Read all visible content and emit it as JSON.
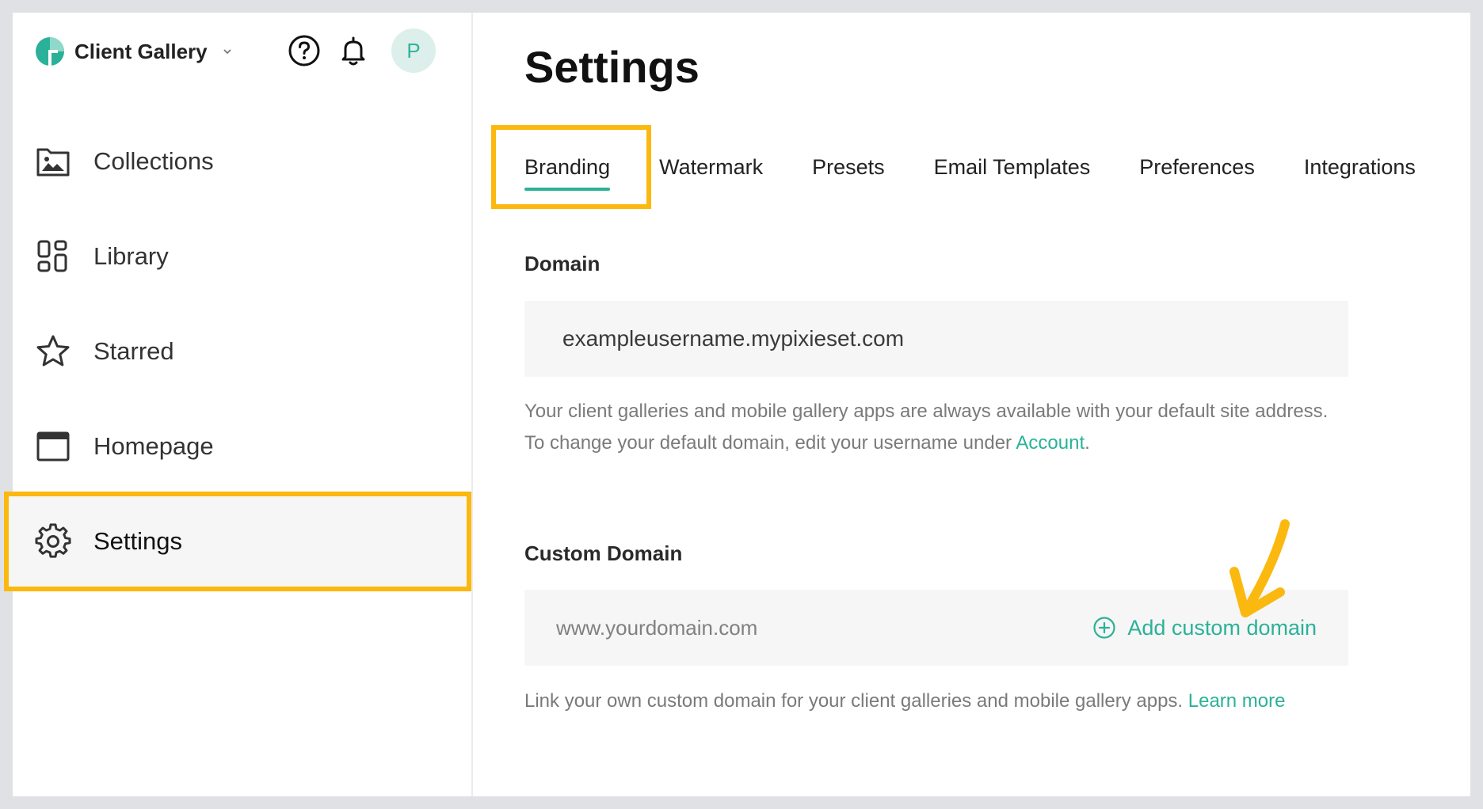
{
  "sidebar": {
    "brand_name": "Client Gallery",
    "avatar_initial": "P",
    "items": [
      {
        "label": "Collections",
        "icon": "image-folder-icon"
      },
      {
        "label": "Library",
        "icon": "grid-icon"
      },
      {
        "label": "Starred",
        "icon": "star-icon"
      },
      {
        "label": "Homepage",
        "icon": "browser-window-icon"
      },
      {
        "label": "Settings",
        "icon": "gear-icon",
        "active": true
      }
    ]
  },
  "main": {
    "title": "Settings",
    "tabs": [
      {
        "label": "Branding",
        "active": true
      },
      {
        "label": "Watermark"
      },
      {
        "label": "Presets"
      },
      {
        "label": "Email Templates"
      },
      {
        "label": "Preferences"
      },
      {
        "label": "Integrations"
      }
    ],
    "domain": {
      "label": "Domain",
      "value": "exampleusername.mypixieset.com",
      "help_text": "Your client galleries and mobile gallery apps are always available with your default site address. To change your default domain, edit your username under ",
      "help_link": "Account",
      "help_suffix": "."
    },
    "custom_domain": {
      "label": "Custom Domain",
      "placeholder": "www.yourdomain.com",
      "add_label": "Add custom domain",
      "help_text": "Link your own custom domain for your client galleries and mobile gallery apps. ",
      "help_link": "Learn more"
    }
  },
  "colors": {
    "accent": "#2bb199",
    "highlight": "#fbb80f"
  }
}
